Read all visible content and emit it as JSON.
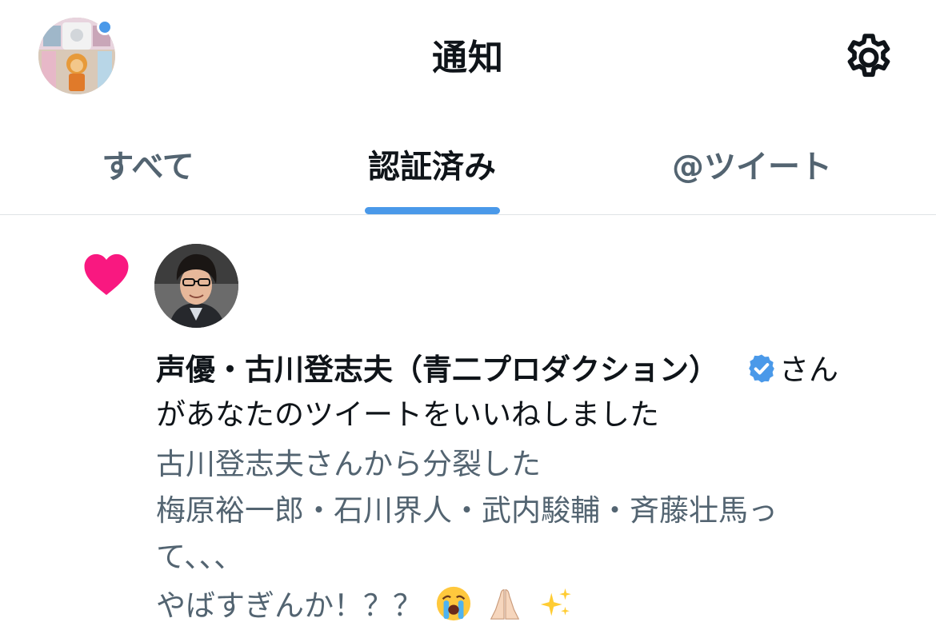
{
  "header": {
    "title": "通知",
    "has_unread_indicator": true,
    "avatar_icon": "user-avatar",
    "settings_icon": "gear-icon"
  },
  "tabs": [
    {
      "label": "すべて",
      "active": false
    },
    {
      "label": "認証済み",
      "active": true
    },
    {
      "label": "@ツイート",
      "active": false
    }
  ],
  "notification": {
    "type_icon": "heart-icon",
    "icon_color": "#f91880",
    "user_name": "声優・古川登志夫（青二プロダクション）",
    "verified": true,
    "name_suffix": "さん",
    "action_text": "があなたのツイートをいいねしました",
    "preview_lines": [
      "古川登志夫さんから分裂した",
      "梅原裕一郎・石川界人・武内駿輔・斉藤壮馬っ",
      "て、、、",
      "やばすぎんか！？？"
    ],
    "preview_emojis": [
      "crying-face-emoji",
      "folded-hands-emoji",
      "sparkles-emoji"
    ]
  },
  "colors": {
    "accent": "#4a99e9",
    "like": "#f91880",
    "secondary_text": "#536471",
    "primary_text": "#0f1419",
    "divider": "#dfe3e6"
  }
}
